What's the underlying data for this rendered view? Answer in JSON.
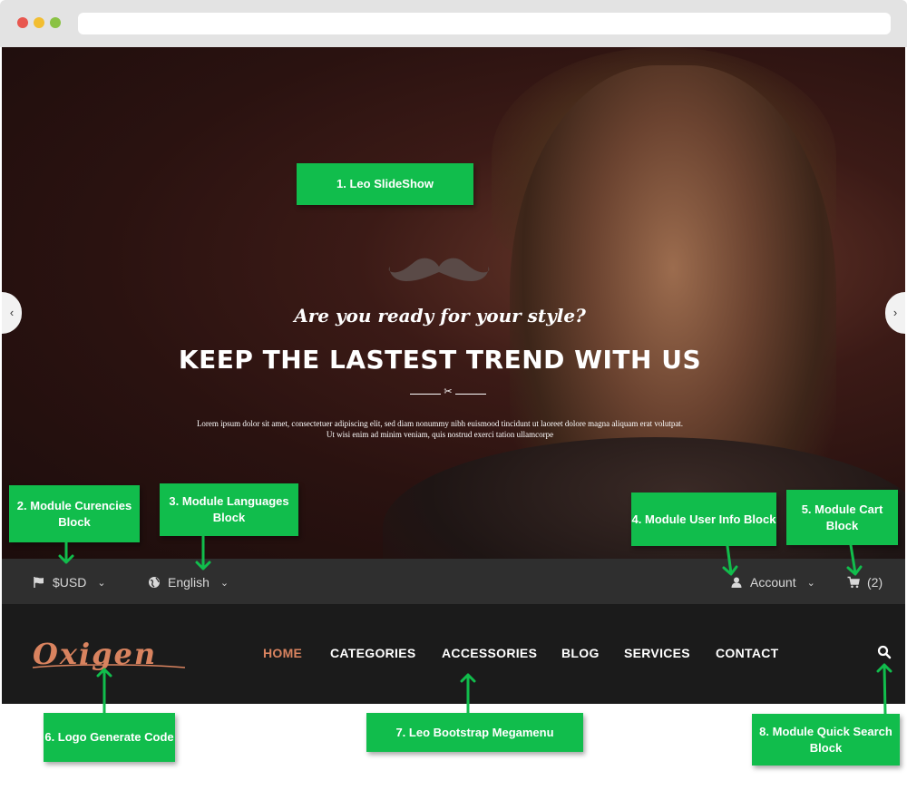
{
  "hero": {
    "subtitle": "Are you ready for your style?",
    "headline": "KEEP THE LASTEST TREND WITH US",
    "body": "Lorem ipsum dolor sit amet, consectetuer adipiscing elit, sed diam nonummy nibh euismood tincidunt ut laoreet dolore magna aliquam erat volutpat. Ut wisi enim ad minim veniam, quis nostrud exerci tation ullamcorpe"
  },
  "topbar": {
    "currency": "$USD",
    "language": "English",
    "account": "Account",
    "cart_count": "(2)"
  },
  "nav": {
    "logo_text": "Oxigen",
    "menu": [
      "HOME",
      "CATEGORIES",
      "ACCESSORIES",
      "BLOG",
      "SERVICES",
      "CONTACT"
    ],
    "active_item": "HOME"
  },
  "labels": {
    "slideshow": "1. Leo SlideShow",
    "currencies": "2. Module Curencies Block",
    "languages": "3. Module Languages  Block",
    "user_info": "4. Module User Info Block",
    "cart": "5. Module Cart Block",
    "logo": "6. Logo Generate Code",
    "megamenu": "7. Leo Bootstrap Megamenu",
    "search": "8. Module Quick Search Block"
  },
  "colors": {
    "label_bg": "#11bd4c",
    "accent": "#d9835f",
    "topbar_bg": "#2f2f2f",
    "navbar_bg": "#1b1b1b"
  },
  "icons": {
    "currency": "flag-icon",
    "language": "globe-icon",
    "account": "user-icon",
    "cart": "cart-icon",
    "search": "search-icon"
  }
}
